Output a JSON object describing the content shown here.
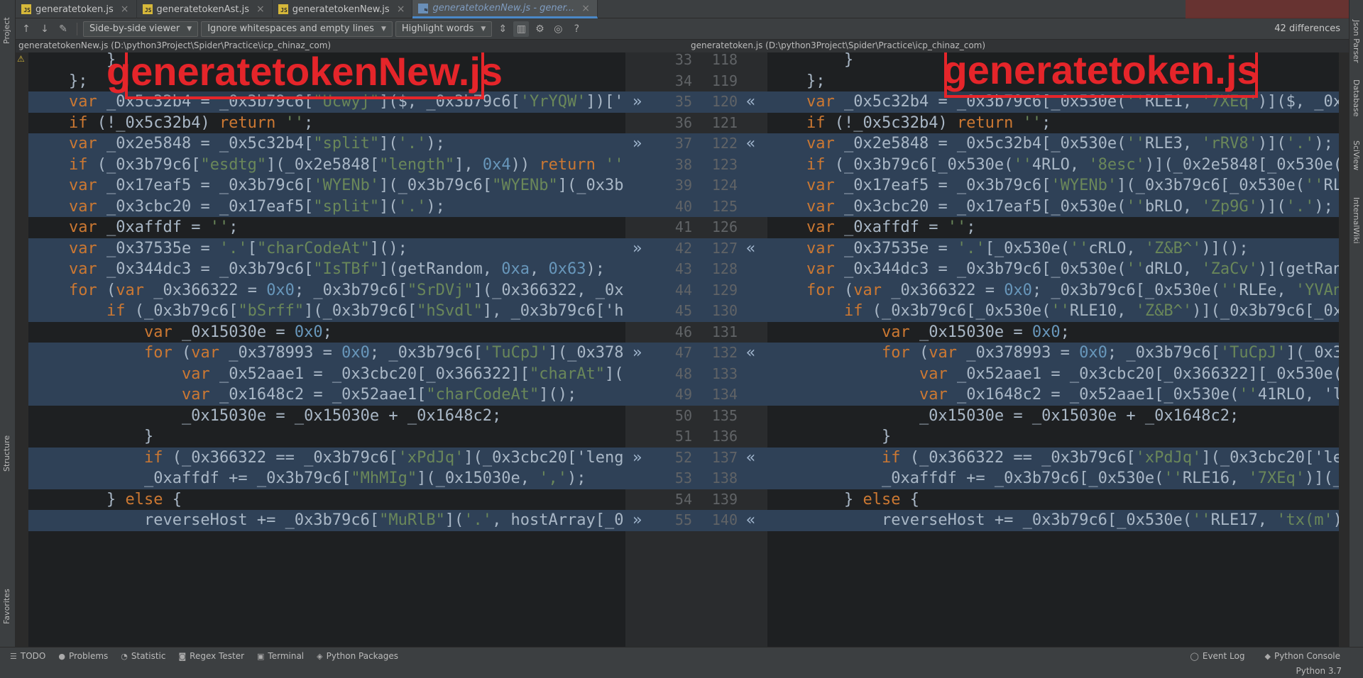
{
  "tabs": [
    {
      "label": "generatetoken.js"
    },
    {
      "label": "generatetokenAst.js"
    },
    {
      "label": "generatetokenNew.js"
    },
    {
      "label": "generatetokenNew.js - gener..."
    }
  ],
  "toolbar": {
    "viewer_mode": "Side-by-side viewer",
    "whitespace_mode": "Ignore whitespaces and empty lines",
    "highlight_mode": "Highlight words",
    "differences": "42 differences"
  },
  "left_sidebar": {
    "project": "Project",
    "structure": "Structure",
    "favorites": "Favorites"
  },
  "right_sidebar": {
    "json_parser": "Json Parser",
    "database": "Database",
    "sciview": "SciView",
    "internalwiki": "InternalWiki"
  },
  "left_file": {
    "path": "generatetokenNew.js (D:\\python3Project\\Spider\\Practice\\icp_chinaz_com)",
    "annotation": "generatetokenNew.js"
  },
  "right_file": {
    "path": "generatetoken.js (D:\\python3Project\\Spider\\Practice\\icp_chinaz_com)",
    "annotation": "generatetoken.js"
  },
  "lines": [
    {
      "l": 33,
      "r": 118,
      "chg": false,
      "left": "    }",
      "right": "    }"
    },
    {
      "l": 34,
      "r": 119,
      "chg": false,
      "left": "};",
      "right": "};"
    },
    {
      "l": 35,
      "r": 120,
      "chg": true,
      "left": "var _0x5c32b4 = _0x3b79c6[\"Ucwyj\"]($, _0x3b79c6['YrYQW'])['",
      "right": "var _0x5c32b4 = _0x3b79c6[_0x530e(''RLE1, '7XEq')]($, _0x3b"
    },
    {
      "l": 36,
      "r": 121,
      "chg": false,
      "left": "if (!_0x5c32b4) return '';",
      "right": "if (!_0x5c32b4) return '';"
    },
    {
      "l": 37,
      "r": 122,
      "chg": true,
      "left": "var _0x2e5848 = _0x5c32b4[\"split\"]('.');",
      "right": "var _0x2e5848 = _0x5c32b4[_0x530e(''RLE3, 'rRV8')]('.');"
    },
    {
      "l": 38,
      "r": 123,
      "chg": true,
      "left": "if (_0x3b79c6[\"esdtg\"](_0x2e5848[\"length\"], 0x4)) return ''",
      "right": "if (_0x3b79c6[_0x530e(''4RLO, '8esc')](_0x2e5848[_0x530e(''5"
    },
    {
      "l": 39,
      "r": 124,
      "chg": true,
      "left": "var _0x17eaf5 = _0x3b79c6['WYENb'](_0x3b79c6[\"WYENb\"](_0x3b",
      "right": "var _0x17eaf5 = _0x3b79c6['WYENb'](_0x3b79c6[_0x530e(''RLE6, '"
    },
    {
      "l": 40,
      "r": 125,
      "chg": true,
      "left": "var _0x3cbc20 = _0x17eaf5[\"split\"]('.');",
      "right": "var _0x3cbc20 = _0x17eaf5[_0x530e(''bRLO, 'Zp9G')]('.');"
    },
    {
      "l": 41,
      "r": 126,
      "chg": false,
      "left": "var _0xaffdf = '';",
      "right": "var _0xaffdf = '';"
    },
    {
      "l": 42,
      "r": 127,
      "chg": true,
      "left": "var _0x37535e = '.'[\"charCodeAt\"]();",
      "right": "var _0x37535e = '.'[_0x530e(''cRLO, 'Z&B^')]();"
    },
    {
      "l": 43,
      "r": 128,
      "chg": true,
      "left": "var _0x344dc3 = _0x3b79c6[\"IsTBf\"](getRandom, 0xa, 0x63);",
      "right": "var _0x344dc3 = _0x3b79c6[_0x530e(''dRLO, 'ZaCv')](getRandom"
    },
    {
      "l": 44,
      "r": 129,
      "chg": true,
      "left": "for (var _0x366322 = 0x0; _0x3b79c6[\"SrDVj\"](_0x366322, _0x",
      "right": "for (var _0x366322 = 0x0; _0x3b79c6[_0x530e(''RLEe, 'YVAn')]("
    },
    {
      "l": 45,
      "r": 130,
      "chg": true,
      "left": "    if (_0x3b79c6[\"bSrff\"](_0x3b79c6[\"hSvdl\"], _0x3b79c6['h",
      "right": "    if (_0x3b79c6[_0x530e(''RLE10, 'Z&B^')](_0x3b79c6[_0x530"
    },
    {
      "l": 46,
      "r": 131,
      "chg": false,
      "left": "        var _0x15030e = 0x0;",
      "right": "        var _0x15030e = 0x0;"
    },
    {
      "l": 47,
      "r": 132,
      "chg": true,
      "left": "        for (var _0x378993 = 0x0; _0x3b79c6['TuCpJ'](_0x378",
      "right": "        for (var _0x378993 = 0x0; _0x3b79c6['TuCpJ'](_0x3789"
    },
    {
      "l": 48,
      "r": 133,
      "chg": true,
      "left": "            var _0x52aae1 = _0x3cbc20[_0x366322][\"charAt\"](",
      "right": "            var _0x52aae1 = _0x3cbc20[_0x366322][_0x530e(''3"
    },
    {
      "l": 49,
      "r": 134,
      "chg": true,
      "left": "            var _0x1648c2 = _0x52aae1[\"charCodeAt\"]();",
      "right": "            var _0x1648c2 = _0x52aae1[_0x530e(''41RLO, 'lD3*"
    },
    {
      "l": 50,
      "r": 135,
      "chg": false,
      "left": "            _0x15030e = _0x15030e + _0x1648c2;",
      "right": "            _0x15030e = _0x15030e + _0x1648c2;"
    },
    {
      "l": 51,
      "r": 136,
      "chg": false,
      "left": "        }",
      "right": "        }"
    },
    {
      "l": 52,
      "r": 137,
      "chg": true,
      "left": "        if (_0x366322 == _0x3b79c6['xPdJq'](_0x3cbc20['leng",
      "right": "        if (_0x366322 == _0x3b79c6['xPdJq'](_0x3cbc20['lengt"
    },
    {
      "l": 53,
      "r": 138,
      "chg": true,
      "left": "        _0xaffdf += _0x3b79c6[\"MhMIg\"](_0x15030e, ',');",
      "right": "        _0xaffdf += _0x3b79c6[_0x530e(''RLE16, '7XEq')](_0x1"
    },
    {
      "l": 54,
      "r": 139,
      "chg": false,
      "left": "    } else {",
      "right": "    } else {"
    },
    {
      "l": 55,
      "r": 140,
      "chg": true,
      "left": "        reverseHost += _0x3b79c6[\"MuRlB\"]('.', hostArray[_0",
      "right": "        reverseHost += _0x3b79c6[_0x530e(''RLE17, 'tx(m')](_"
    }
  ],
  "bottom_tools": [
    {
      "label": "TODO",
      "icon": "list-icon",
      "glyph": "☰"
    },
    {
      "label": "Problems",
      "icon": "problems-icon",
      "glyph": "●"
    },
    {
      "label": "Statistic",
      "icon": "statistic-icon",
      "glyph": "◔"
    },
    {
      "label": "Regex Tester",
      "icon": "regex-icon",
      "glyph": "◙"
    },
    {
      "label": "Terminal",
      "icon": "terminal-icon",
      "glyph": "▣"
    },
    {
      "label": "Python Packages",
      "icon": "packages-icon",
      "glyph": "◈"
    }
  ],
  "right_tools": {
    "event_log": "Event Log",
    "python_console": "Python Console"
  },
  "status": {
    "interpreter": "Python 3.7"
  }
}
